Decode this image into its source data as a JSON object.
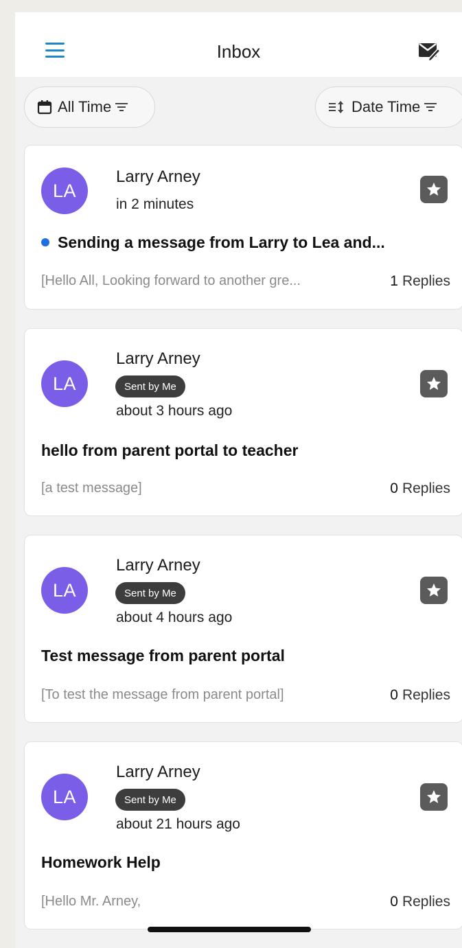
{
  "header": {
    "title": "Inbox",
    "menu_icon": "hamburger-icon",
    "compose_icon": "compose-icon",
    "accent_color": "#1e88c7"
  },
  "filters": {
    "time_filter": {
      "label": "All Time",
      "icon": "calendar-icon",
      "filter_icon": "filter-icon"
    },
    "sort_filter": {
      "label": "Date Time",
      "icon": "sort-icon",
      "filter_icon": "filter-icon"
    }
  },
  "messages": [
    {
      "initials": "LA",
      "sender": "Larry Arney",
      "badge": "",
      "time": "in 2 minutes",
      "unread": true,
      "subject": "Sending a message from Larry to Lea and...",
      "preview": "[Hello All, Looking forward to another gre...",
      "reply_count": "1",
      "replies_label": "Replies"
    },
    {
      "initials": "LA",
      "sender": "Larry Arney",
      "badge": "Sent by Me",
      "time": "about 3 hours ago",
      "unread": false,
      "subject": "hello from parent portal to teacher",
      "preview": "[a test message]",
      "reply_count": "0",
      "replies_label": "Replies"
    },
    {
      "initials": "LA",
      "sender": "Larry Arney",
      "badge": "Sent by Me",
      "time": "about 4 hours ago",
      "unread": false,
      "subject": "Test message from parent portal",
      "preview": "[To test the message from parent portal]",
      "reply_count": "0",
      "replies_label": "Replies"
    },
    {
      "initials": "LA",
      "sender": "Larry Arney",
      "badge": "Sent by Me",
      "time": "about 21 hours ago",
      "unread": false,
      "subject": "Homework Help",
      "preview": "[Hello Mr. Arney,",
      "reply_count": "0",
      "replies_label": "Replies"
    }
  ],
  "colors": {
    "avatar": "#7b5ee8",
    "unread_dot": "#1f6fe0",
    "badge_bg": "#3d3d3d",
    "star_bg": "#5b5b5b"
  }
}
